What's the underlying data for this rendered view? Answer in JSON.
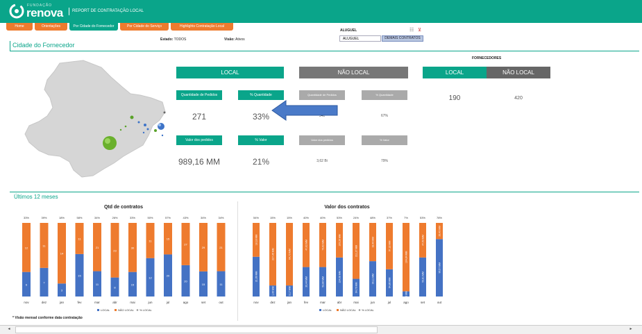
{
  "app": {
    "logo_small": "FUNDAÇÃO",
    "logo_word": "renova",
    "report_title": "REPORT DE CONTRATAÇÃO LOCAL"
  },
  "nav": [
    {
      "label": "Home"
    },
    {
      "label": "Orientações"
    },
    {
      "label": "Por Cidade do Fornecedor"
    },
    {
      "label": "Por Cidade do Serviço"
    },
    {
      "label": "Highlights Contratação Local"
    }
  ],
  "filters": {
    "estado_label": "Estado:",
    "estado_value": "TODOS",
    "visao_label": "Visão:",
    "visao_value": "Ativos",
    "aluguel_label": "ALUGUEL",
    "aluguel_box": "ALUGUEL",
    "demais_button": "DEMAIS CONTRATOS"
  },
  "page_title": "Cidade do Fornecedor",
  "kpi": {
    "local_header": "LOCAL",
    "nao_local_header": "NÃO LOCAL",
    "local": {
      "qtd_label": "Quantidade de Pedidos",
      "qtd_value": "271",
      "pct_qtd_label": "% Quantidade",
      "pct_qtd_value": "33%",
      "valor_label": "Valor dos pedidos",
      "valor_value": "989,16 MM",
      "pct_valor_label": "% Valor",
      "pct_valor_value": "21%"
    },
    "nao_local": {
      "qtd_label": "Quantidade de Pedidos",
      "qtd_value": "541",
      "pct_qtd_label": "% Quantidade",
      "pct_qtd_value": "67%",
      "valor_label": "Valor dos pedidos",
      "valor_value": "3,62 Bi",
      "pct_valor_label": "% Valor",
      "pct_valor_value": "79%"
    },
    "fornecedores": {
      "title": "FORNECEDORES",
      "local_header": "LOCAL",
      "nao_local_header": "NÃO LOCAL",
      "local_value": "190",
      "nao_local_value": "420"
    }
  },
  "section2_title": "Últimos 12 meses",
  "footnote": "* Visão mensal conforme data contratação",
  "colors": {
    "teal": "#0aa58a",
    "orange": "#ee7b2e",
    "blue": "#4472c4",
    "grey": "#777777"
  },
  "chart_data": [
    {
      "type": "bar",
      "stacked": true,
      "title": "Qtd de contratos",
      "categories": [
        "nov",
        "dez",
        "jan",
        "fev",
        "mar",
        "abr",
        "mai",
        "jun",
        "jul",
        "ago",
        "set",
        "out"
      ],
      "series": [
        {
          "name": "LOCAL",
          "values": [
            6,
            7,
            3,
            15,
            11,
            8,
            15,
            12,
            20,
            20,
            15,
            11
          ]
        },
        {
          "name": "NÃO LOCAL",
          "values": [
            12,
            11,
            14,
            11,
            21,
            23,
            30,
            11,
            15,
            27,
            29,
            21
          ]
        }
      ],
      "pct_labels": [
        "33%",
        "39%",
        "18%",
        "58%",
        "34%",
        "26%",
        "33%",
        "50%",
        "57%",
        "43%",
        "34%",
        "34%"
      ],
      "legend": [
        "LOCAL",
        "NÃO LOCAL",
        "% LOCAL"
      ],
      "legend_position": "bottom"
    },
    {
      "type": "bar",
      "stacked": true,
      "title": "Valor dos contratos",
      "categories": [
        "nov",
        "dez",
        "jan",
        "fev",
        "mar",
        "abr",
        "mai",
        "jun",
        "jul",
        "ago",
        "set",
        "out"
      ],
      "local_labels": [
        "21,09 MM",
        "1,49 MM",
        "3,17 MM",
        "20,44 MM",
        "52,86 MM",
        "124,08 MM",
        "64,76 MM",
        "30,11 MM",
        "64,86 MM",
        "8 MM",
        "53,81 MM",
        "96,57 MM"
      ],
      "nao_local_labels": [
        "18,18 MM",
        "227,45 MM",
        "64,73 MM",
        "47,02 MM",
        "79,62 MM",
        "109,26 MM",
        "211,27 MM",
        "32,46 MM",
        "97,22 MM",
        "104,84 MM",
        "47,53 MM",
        "28,43 MM"
      ],
      "pct_labels": [
        "54%",
        "15%",
        "15%",
        "40%",
        "40%",
        "53%",
        "24%",
        "48%",
        "37%",
        "7%",
        "53%",
        "78%"
      ],
      "local_share": [
        54,
        15,
        15,
        40,
        40,
        53,
        24,
        48,
        37,
        7,
        53,
        78
      ],
      "legend": [
        "LOCAL",
        "NÃO LOCAL",
        "% LOCAL"
      ],
      "legend_position": "bottom"
    }
  ]
}
